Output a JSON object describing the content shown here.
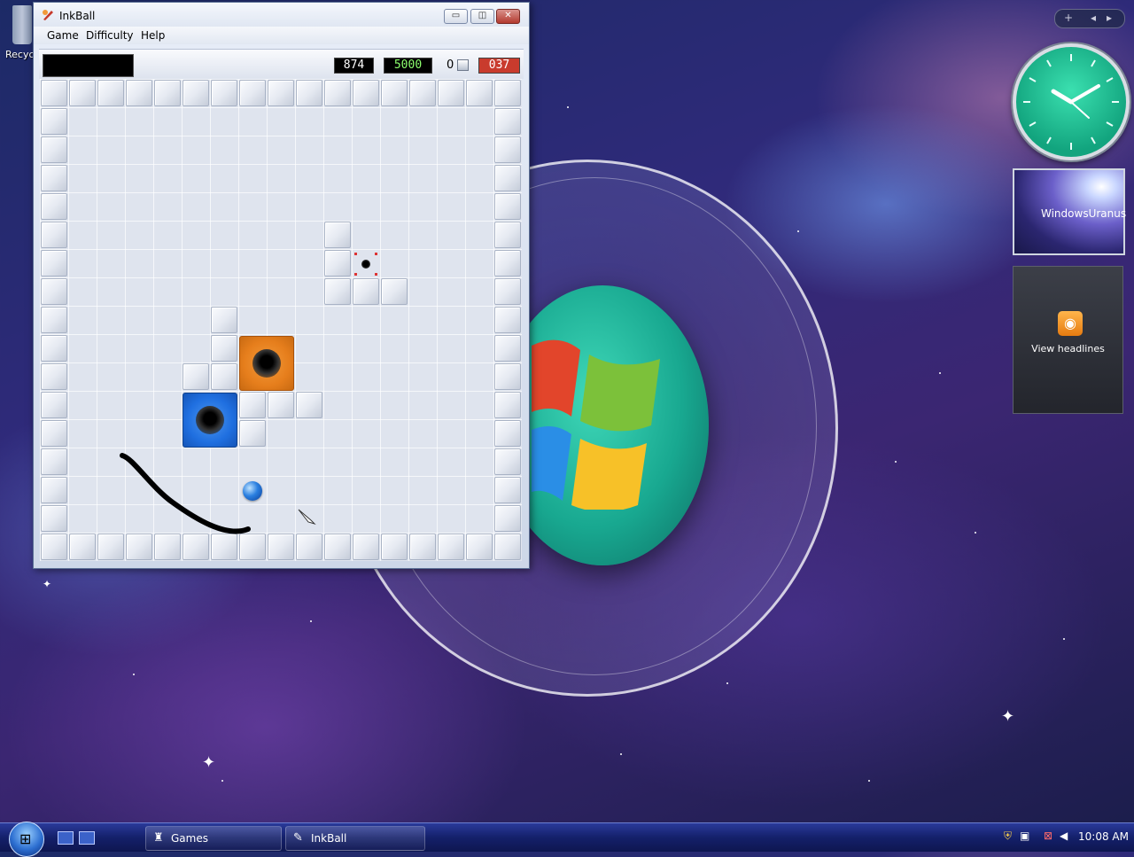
{
  "desktop": {
    "recycle_label": "Recyc"
  },
  "window": {
    "title": "InkBall",
    "minimize_label": "▭",
    "maximize_label": "◫",
    "close_label": "✕",
    "menu": [
      "Game",
      "Difficulty",
      "Help"
    ]
  },
  "status": {
    "score": "874",
    "best_score": "5000",
    "balls_count": "0",
    "time": "037"
  },
  "board": {
    "grid_cells": 17,
    "hole_colors": {
      "orange": "#e67e1c",
      "blue": "#1f6fe0",
      "ball": "#2a7fe0"
    }
  },
  "sidebar": {
    "add_label": "+",
    "prev_label": "◂",
    "next_label": "▸",
    "slideshow_caption": "WindowsUranus",
    "feeds_label": "View headlines"
  },
  "taskbar": {
    "tasks": [
      {
        "icon": "games-icon",
        "label": "Games"
      },
      {
        "icon": "inkball-icon",
        "label": "InkBall"
      }
    ],
    "clock": "10:08 AM"
  },
  "colors": {
    "taskbar": "#14206a",
    "clock_face": "#12a47e"
  }
}
